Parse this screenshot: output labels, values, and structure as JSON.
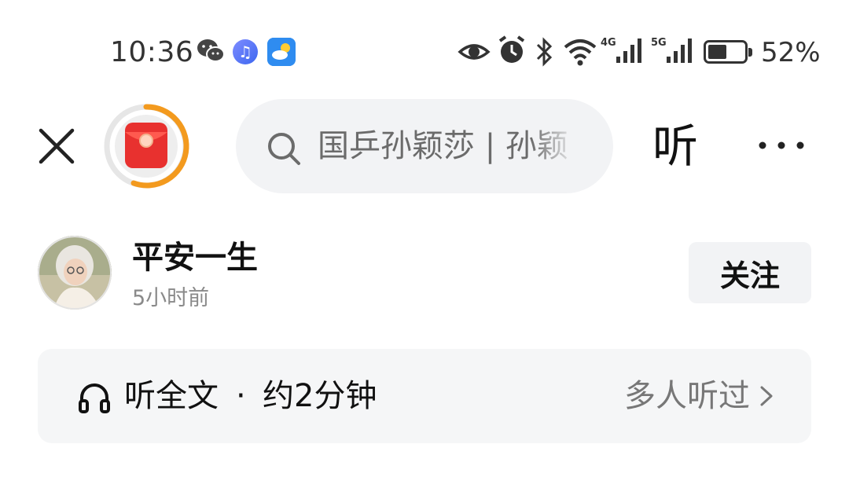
{
  "status_bar": {
    "time": "10:36",
    "battery_percent": "52%",
    "battery_level": 0.52,
    "network_1": "4G",
    "network_2": "5G",
    "icons": [
      "wechat-icon",
      "music-icon",
      "weather-icon",
      "eye-icon",
      "alarm-icon",
      "bluetooth-icon",
      "wifi-icon",
      "signal-icon",
      "signal-icon",
      "battery-icon"
    ]
  },
  "nav": {
    "search_placeholder": "国乒孙颖莎 | 孙颖",
    "listen_label": "听"
  },
  "author": {
    "name": "平安一生",
    "time_ago": "5小时前",
    "follow_label": "关注"
  },
  "listen_bar": {
    "label": "听全文",
    "dot": "·",
    "duration": "约2分钟",
    "right_label": "多人听过"
  },
  "colors": {
    "accent_orange": "#f39a1e",
    "red_packet": "#e8312f",
    "search_bg": "#f2f3f5"
  }
}
